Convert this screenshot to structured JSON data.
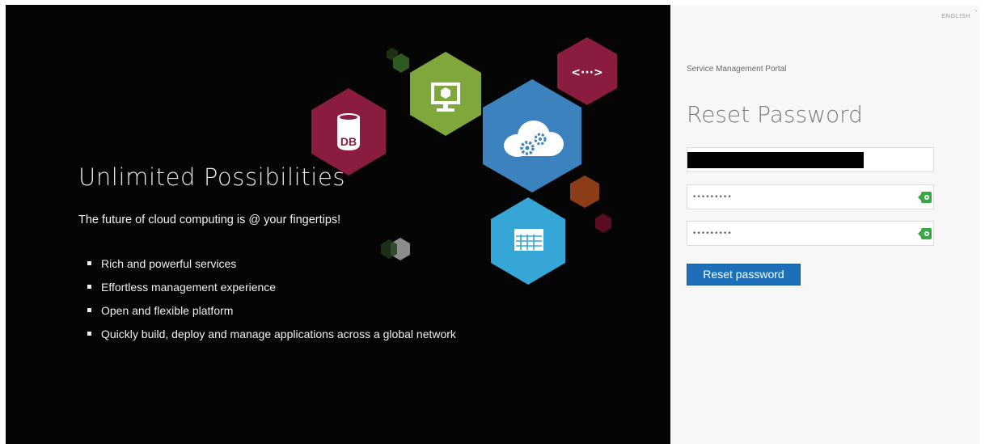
{
  "hero": {
    "title": "Unlimited Possibilities",
    "subtitle": "The future of cloud computing is @ your fingertips!",
    "bullets": [
      "Rich and powerful services",
      "Effortless management experience",
      "Open and flexible platform",
      "Quickly build, deploy and manage applications across a global network"
    ],
    "tile_labels": {
      "database": "DB",
      "code": "<···>"
    },
    "colors": {
      "background": "#050505",
      "database_tile": "#8a1c3f",
      "monitor_tile": "#7fa73b",
      "cloud_tile": "#3b82bf",
      "table_tile": "#36a6d6",
      "code_tile": "#8a1c3f",
      "accent_orange": "#8a3d17"
    }
  },
  "panel": {
    "language": "ENGLISH",
    "portal_name": "Service Management Portal",
    "title": "Reset Password",
    "fields": {
      "username_value": "",
      "password_value": "•••••••••",
      "confirm_value": "•••••••••"
    },
    "submit_label": "Reset password",
    "colors": {
      "button": "#1c6fb8",
      "key_icon": "#3aa845"
    }
  }
}
